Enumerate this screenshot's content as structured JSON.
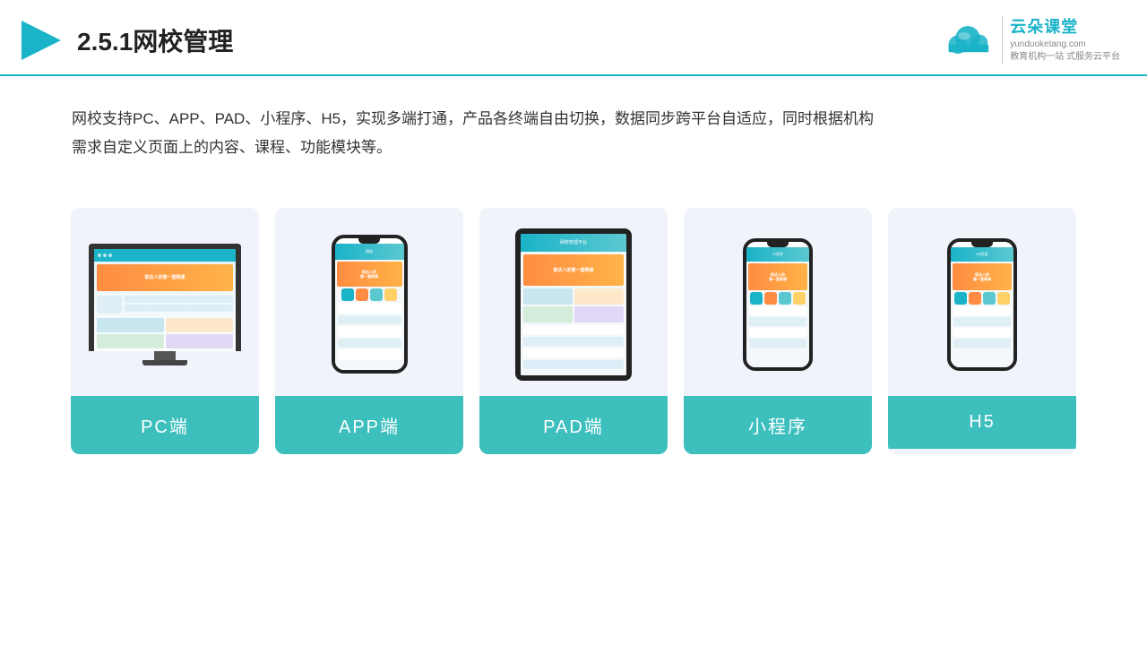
{
  "header": {
    "title": "2.5.1网校管理",
    "logo_name": "云朵课堂",
    "logo_url": "yunduoketang.com",
    "logo_tagline1": "教育机构一站",
    "logo_tagline2": "式服务云平台"
  },
  "description": {
    "line1": "网校支持PC、APP、PAD、小程序、H5，实现多端打通，产品各终端自由切换，数据同步跨平台自适应，同时根据机构",
    "line2": "需求自定义页面上的内容、课程、功能模块等。"
  },
  "cards": [
    {
      "id": "pc",
      "label": "PC端"
    },
    {
      "id": "app",
      "label": "APP端"
    },
    {
      "id": "pad",
      "label": "PAD端"
    },
    {
      "id": "miniprogram",
      "label": "小程序"
    },
    {
      "id": "h5",
      "label": "H5"
    }
  ]
}
